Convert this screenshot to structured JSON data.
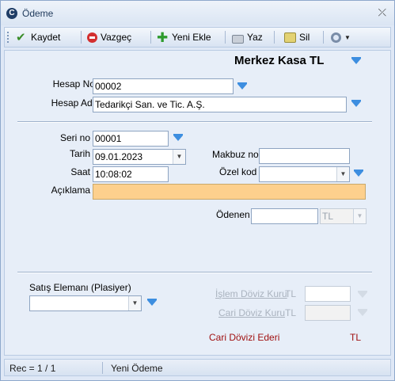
{
  "window": {
    "title": "Ödeme"
  },
  "toolbar": {
    "save_label": "Kaydet",
    "cancel_label": "Vazgeç",
    "new_label": "Yeni Ekle",
    "print_label": "Yaz",
    "delete_label": "Sil"
  },
  "header": {
    "kasa_name": "Merkez Kasa TL"
  },
  "account": {
    "hesap_no_label": "Hesap No",
    "hesap_no_value": "00002",
    "hesap_adi_label": "Hesap Adı",
    "hesap_adi_value": "Tedarikçi San. ve Tic. A.Ş."
  },
  "form": {
    "seri_no_label": "Seri no",
    "seri_no_value": "00001",
    "tarih_label": "Tarih",
    "tarih_value": "09.01.2023",
    "saat_label": "Saat",
    "saat_value": "10:08:02",
    "makbuz_no_label": "Makbuz no",
    "makbuz_no_value": "",
    "ozel_kod_label": "Özel kod",
    "ozel_kod_value": "",
    "aciklama_label": "Açıklama",
    "aciklama_value": "",
    "odenen_label": "Ödenen",
    "odenen_value": "",
    "odenen_currency": "TL"
  },
  "bottom": {
    "satis_elemani_label": "Satış Elemanı (Plasiyer)",
    "satis_elemani_value": "",
    "islem_doviz_label": "İşlem Döviz Kuru",
    "islem_doviz_currency": "TL",
    "cari_doviz_label": "Cari Döviz Kuru",
    "cari_doviz_currency": "TL",
    "cari_dovizi_ederi_label": "Cari Dövizi Ederi",
    "cari_dovizi_ederi_currency": "TL"
  },
  "status": {
    "record": "Rec = 1 / 1",
    "mode": "Yeni Ödeme"
  },
  "colors": {
    "accent_blue": "#3d8ee0",
    "aciklama_bg": "#fdd08d",
    "ederi_text": "#a01010"
  }
}
